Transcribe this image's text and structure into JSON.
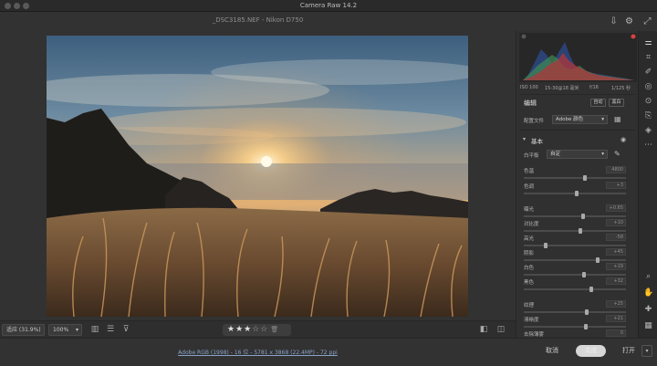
{
  "window": {
    "title": "Camera Raw 14.2",
    "file_title": "_DSC3185.NEF - Nikon D750"
  },
  "top_icons": [
    "save-icon",
    "gear-icon",
    "fullscreen-icon"
  ],
  "view_bar": {
    "zoom_fit": "适应 (31.9%)",
    "zoom_pct": "100%",
    "rating": 3,
    "rating_max": 5
  },
  "panel": {
    "exif": {
      "iso": "ISO 100",
      "lens": "15-30@18 毫米",
      "aperture": "f/16",
      "shutter": "1/125 秒"
    },
    "edit_title": "编辑",
    "auto_label": "自动",
    "bw_label": "黑白",
    "profile_label": "配置文件",
    "profile_value": "Adobe 颜色",
    "basic_title": "基本",
    "wb_label": "白平衡",
    "wb_value": "自定",
    "sliders": [
      {
        "label": "色温",
        "value": "4800",
        "pos": 0.6
      },
      {
        "label": "色调",
        "value": "+3",
        "pos": 0.52
      },
      {
        "label": "曝光",
        "value": "+0.65",
        "pos": 0.58
      },
      {
        "label": "对比度",
        "value": "+10",
        "pos": 0.55
      },
      {
        "label": "高光",
        "value": "-58",
        "pos": 0.21
      },
      {
        "label": "阴影",
        "value": "+45",
        "pos": 0.72
      },
      {
        "label": "白色",
        "value": "+19",
        "pos": 0.59
      },
      {
        "label": "黑色",
        "value": "+32",
        "pos": 0.66
      },
      {
        "label": "纹理",
        "value": "+25",
        "pos": 0.62
      },
      {
        "label": "清晰度",
        "value": "+21",
        "pos": 0.61
      },
      {
        "label": "去除薄雾",
        "value": "0",
        "pos": 0.5
      }
    ]
  },
  "footer": {
    "workflow": "Adobe RGB (1998) - 16 位 - 5781 x 3868 (22.4MP) - 72 ppi",
    "cancel": "取消",
    "done": "完成",
    "open": "打开"
  },
  "colors": {
    "background": "#323232",
    "panel": "#303030",
    "link": "#8aa2c6"
  }
}
